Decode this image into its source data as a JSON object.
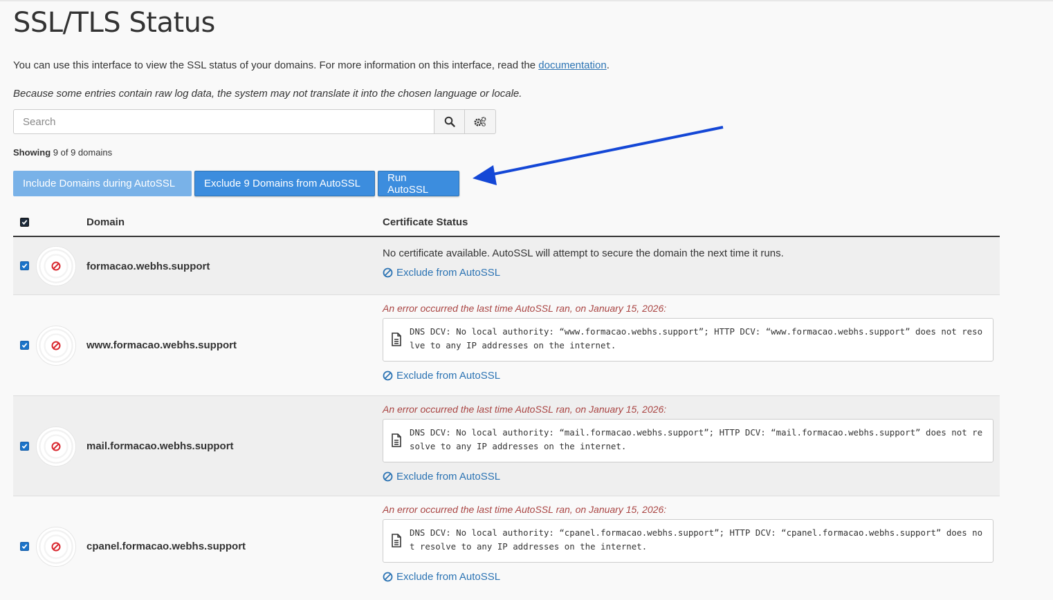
{
  "page": {
    "title": "SSL/TLS Status",
    "intro_text": "You can use this interface to view the SSL status of your domains. For more information on this interface, read the ",
    "intro_link": "documentation",
    "intro_end": ".",
    "note": "Because some entries contain raw log data, the system may not translate it into the chosen language or locale."
  },
  "search": {
    "placeholder": "Search",
    "value": ""
  },
  "showing": {
    "label": "Showing",
    "text": "9 of 9 domains"
  },
  "buttons": {
    "include": "Include Domains during AutoSSL",
    "exclude": "Exclude 9 Domains from AutoSSL",
    "run": "Run AutoSSL"
  },
  "table": {
    "col_domain": "Domain",
    "col_status": "Certificate Status",
    "exclude_label": "Exclude from AutoSSL",
    "rows": [
      {
        "domain": "formacao.webhs.support",
        "message": "No certificate available. AutoSSL will attempt to secure the domain the next time it runs."
      },
      {
        "domain": "www.formacao.webhs.support",
        "error": "An error occurred the last time AutoSSL ran, on January 15, 2026:",
        "log": "DNS DCV: No local authority: “www.formacao.webhs.support”; HTTP DCV: “www.formacao.webhs.support” does not resolve to any IP addresses on the internet."
      },
      {
        "domain": "mail.formacao.webhs.support",
        "error": "An error occurred the last time AutoSSL ran, on January 15, 2026:",
        "log": "DNS DCV: No local authority: “mail.formacao.webhs.support”; HTTP DCV: “mail.formacao.webhs.support” does not resolve to any IP addresses on the internet."
      },
      {
        "domain": "cpanel.formacao.webhs.support",
        "error": "An error occurred the last time AutoSSL ran, on January 15, 2026:",
        "log": "DNS DCV: No local authority: “cpanel.formacao.webhs.support”; HTTP DCV: “cpanel.formacao.webhs.support” does not resolve to any IP addresses on the internet."
      }
    ]
  },
  "colors": {
    "primary": "#3c8dde",
    "link": "#2b73b3",
    "error": "#a94442",
    "annotation_arrow": "#1447d6"
  }
}
